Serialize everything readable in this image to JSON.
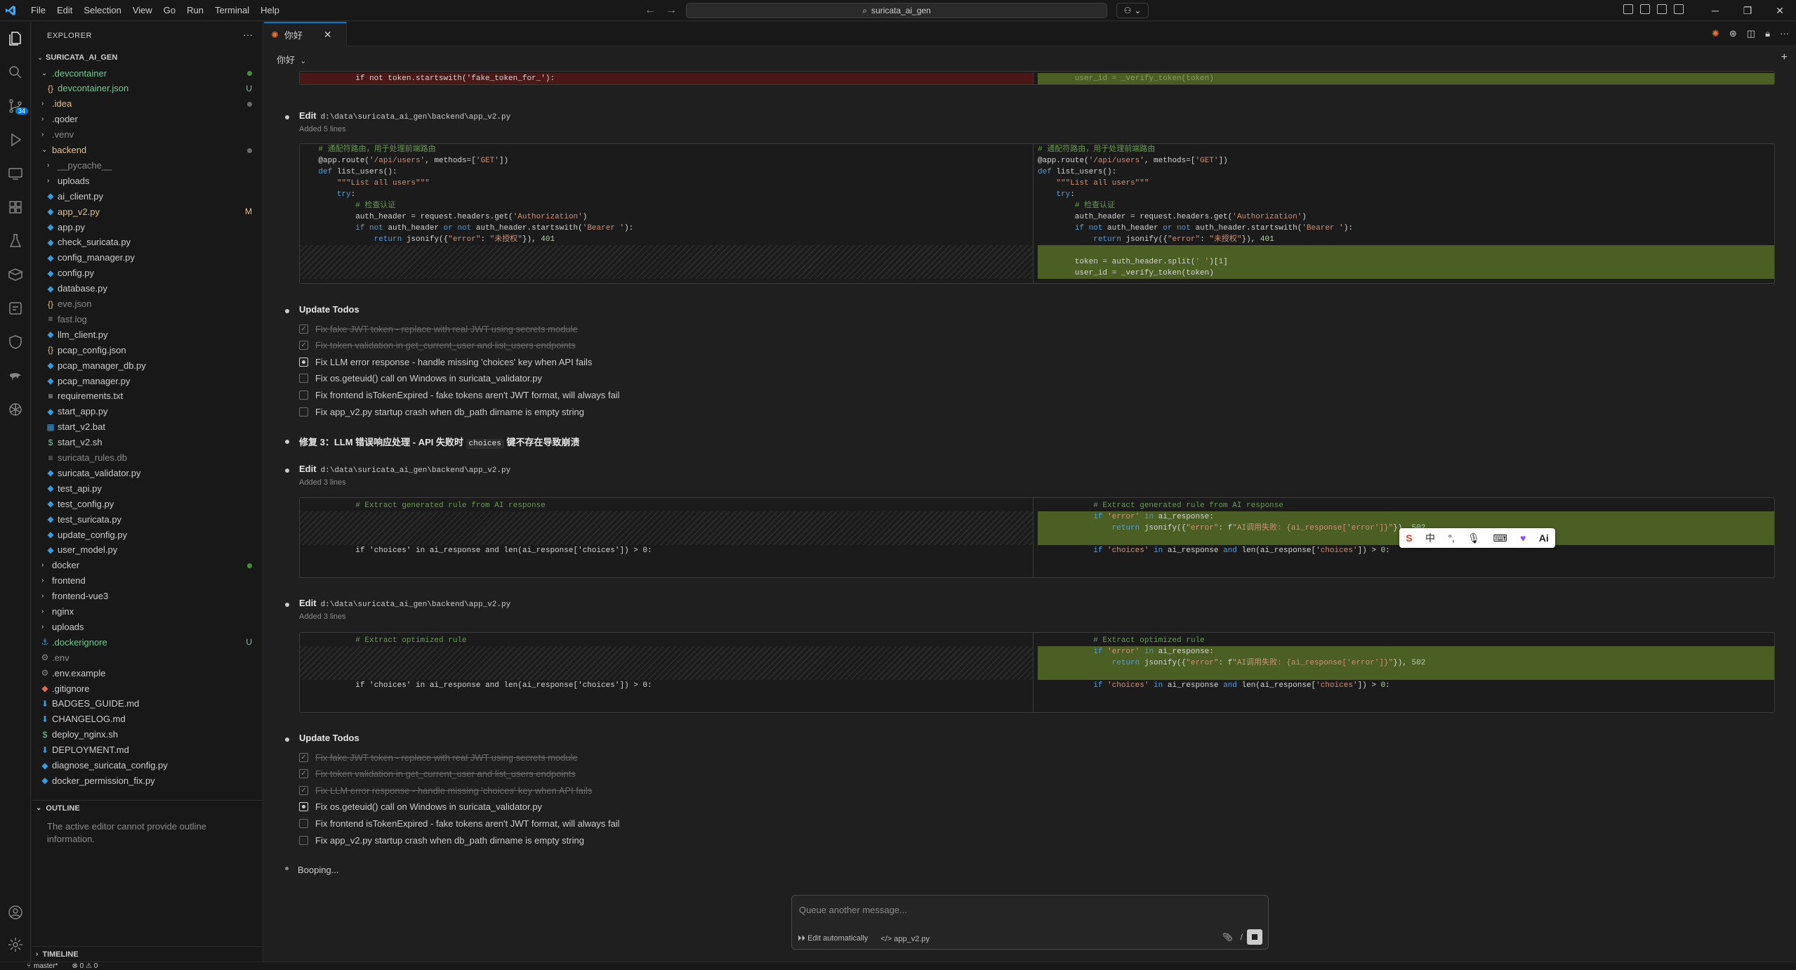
{
  "titlebar": {
    "menu": [
      "File",
      "Edit",
      "Selection",
      "View",
      "Go",
      "Run",
      "Terminal",
      "Help"
    ],
    "search": "suricata_ai_gen"
  },
  "activity": {
    "badge": "34"
  },
  "explorer": {
    "header": "EXPLORER",
    "root": "SURICATA_AI_GEN",
    "rows": [
      {
        "name": ".devcontainer",
        "type": "folder",
        "open": true,
        "level": 1,
        "color": "#73c991",
        "status": "dot"
      },
      {
        "name": "devcontainer.json",
        "type": "json",
        "level": 2,
        "color": "#73c991",
        "status": "U"
      },
      {
        "name": ".idea",
        "type": "folder",
        "level": 1,
        "color": "#e2c08d",
        "status": "dotg"
      },
      {
        "name": ".qoder",
        "type": "folder",
        "level": 1,
        "color": "#cccccc",
        "status": ""
      },
      {
        "name": ".venv",
        "type": "folder",
        "level": 1,
        "color": "#8a8a8a",
        "status": ""
      },
      {
        "name": "backend",
        "type": "folder",
        "open": true,
        "level": 1,
        "color": "#e2c08d",
        "status": "dotg"
      },
      {
        "name": "__pycache__",
        "type": "folder",
        "level": 2,
        "color": "#8a8a8a",
        "status": ""
      },
      {
        "name": "uploads",
        "type": "folder",
        "level": 2,
        "color": "#cccccc",
        "status": ""
      },
      {
        "name": "ai_client.py",
        "type": "py",
        "level": 2,
        "color": "#cccccc",
        "status": ""
      },
      {
        "name": "app_v2.py",
        "type": "py",
        "level": 2,
        "color": "#e2c08d",
        "status": "M"
      },
      {
        "name": "app.py",
        "type": "py",
        "level": 2,
        "color": "#cccccc",
        "status": ""
      },
      {
        "name": "check_suricata.py",
        "type": "py",
        "level": 2,
        "color": "#cccccc",
        "status": ""
      },
      {
        "name": "config_manager.py",
        "type": "py",
        "level": 2,
        "color": "#cccccc",
        "status": ""
      },
      {
        "name": "config.py",
        "type": "py",
        "level": 2,
        "color": "#cccccc",
        "status": ""
      },
      {
        "name": "database.py",
        "type": "py",
        "level": 2,
        "color": "#cccccc",
        "status": ""
      },
      {
        "name": "eve.json",
        "type": "json",
        "level": 2,
        "color": "#8a8a8a",
        "status": ""
      },
      {
        "name": "fast.log",
        "type": "log",
        "level": 2,
        "color": "#8a8a8a",
        "status": ""
      },
      {
        "name": "llm_client.py",
        "type": "py",
        "level": 2,
        "color": "#cccccc",
        "status": ""
      },
      {
        "name": "pcap_config.json",
        "type": "json",
        "level": 2,
        "color": "#cccccc",
        "status": ""
      },
      {
        "name": "pcap_manager_db.py",
        "type": "py",
        "level": 2,
        "color": "#cccccc",
        "status": ""
      },
      {
        "name": "pcap_manager.py",
        "type": "py",
        "level": 2,
        "color": "#cccccc",
        "status": ""
      },
      {
        "name": "requirements.txt",
        "type": "txt",
        "level": 2,
        "color": "#cccccc",
        "status": ""
      },
      {
        "name": "start_app.py",
        "type": "py",
        "level": 2,
        "color": "#cccccc",
        "status": ""
      },
      {
        "name": "start_v2.bat",
        "type": "bat",
        "level": 2,
        "color": "#cccccc",
        "status": ""
      },
      {
        "name": "start_v2.sh",
        "type": "sh",
        "level": 2,
        "color": "#cccccc",
        "status": ""
      },
      {
        "name": "suricata_rules.db",
        "type": "db",
        "level": 2,
        "color": "#8a8a8a",
        "status": ""
      },
      {
        "name": "suricata_validator.py",
        "type": "py",
        "level": 2,
        "color": "#cccccc",
        "status": ""
      },
      {
        "name": "test_api.py",
        "type": "py",
        "level": 2,
        "color": "#cccccc",
        "status": ""
      },
      {
        "name": "test_config.py",
        "type": "py",
        "level": 2,
        "color": "#cccccc",
        "status": ""
      },
      {
        "name": "test_suricata.py",
        "type": "py",
        "level": 2,
        "color": "#cccccc",
        "status": ""
      },
      {
        "name": "update_config.py",
        "type": "py",
        "level": 2,
        "color": "#cccccc",
        "status": ""
      },
      {
        "name": "user_model.py",
        "type": "py",
        "level": 2,
        "color": "#cccccc",
        "status": ""
      },
      {
        "name": "docker",
        "type": "folder",
        "level": 1,
        "color": "#cccccc",
        "status": "dot"
      },
      {
        "name": "frontend",
        "type": "folder",
        "level": 1,
        "color": "#cccccc",
        "status": ""
      },
      {
        "name": "frontend-vue3",
        "type": "folder",
        "level": 1,
        "color": "#cccccc",
        "status": ""
      },
      {
        "name": "nginx",
        "type": "folder",
        "level": 1,
        "color": "#cccccc",
        "status": ""
      },
      {
        "name": "uploads",
        "type": "folder",
        "level": 1,
        "color": "#cccccc",
        "status": ""
      },
      {
        "name": ".dockerignore",
        "type": "docker",
        "level": 1,
        "color": "#73c991",
        "status": "U"
      },
      {
        "name": ".env",
        "type": "env",
        "level": 1,
        "color": "#8a8a8a",
        "status": ""
      },
      {
        "name": ".env.example",
        "type": "env",
        "level": 1,
        "color": "#cccccc",
        "status": ""
      },
      {
        "name": ".gitignore",
        "type": "git",
        "level": 1,
        "color": "#cccccc",
        "status": ""
      },
      {
        "name": "BADGES_GUIDE.md",
        "type": "md",
        "level": 1,
        "color": "#cccccc",
        "status": ""
      },
      {
        "name": "CHANGELOG.md",
        "type": "md",
        "level": 1,
        "color": "#cccccc",
        "status": ""
      },
      {
        "name": "deploy_nginx.sh",
        "type": "sh",
        "level": 1,
        "color": "#cccccc",
        "status": ""
      },
      {
        "name": "DEPLOYMENT.md",
        "type": "md",
        "level": 1,
        "color": "#cccccc",
        "status": ""
      },
      {
        "name": "diagnose_suricata_config.py",
        "type": "py",
        "level": 1,
        "color": "#cccccc",
        "status": ""
      },
      {
        "name": "docker_permission_fix.py",
        "type": "py",
        "level": 1,
        "color": "#cccccc",
        "status": ""
      }
    ],
    "outline_header": "OUTLINE",
    "outline_message": "The active editor cannot provide outline information.",
    "timeline_header": "TIMELINE"
  },
  "tab": {
    "label": "你好"
  },
  "crumb": "你好",
  "edit1": {
    "title": "Edit",
    "path": "d:\\data\\suricata_ai_gen\\backend\\app_v2.py",
    "sub": "Added 5 lines",
    "left": [
      "    # 通配符路由，用于处理前端路由",
      "    @app.route('/api/users', methods=['GET'])",
      "    def list_users():",
      "        \"\"\"List all users\"\"\"",
      "        try:",
      "            # 检查认证",
      "            auth_header = request.headers.get('Authorization')",
      "            if not auth_header or not auth_header.startswith('Bearer '):",
      "                return jsonify({\"error\": \"未授权\"}), 401"
    ],
    "right": [
      "# 通配符路由，用于处理前端路由",
      "@app.route('/api/users', methods=['GET'])",
      "def list_users():",
      "    \"\"\"List all users\"\"\"",
      "    try:",
      "        # 检查认证",
      "        auth_header = request.headers.get('Authorization')",
      "        if not auth_header or not auth_header.startswith('Bearer '):",
      "            return jsonify({\"error\": \"未授权\"}), 401",
      "",
      "        token = auth_header.split(' ')[1]",
      "        user_id = _verify_token(token)"
    ]
  },
  "top_snippet": {
    "left": "            if not token.startswith('fake_token_for_'):",
    "right": "        user_id = _verify_token(token)"
  },
  "todos1": {
    "title": "Update Todos",
    "items": [
      {
        "text": "Fix fake JWT token - replace with real JWT using secrets module",
        "state": "done"
      },
      {
        "text": "Fix token validation in get_current_user and list_users endpoints",
        "state": "done"
      },
      {
        "text": "Fix LLM error response - handle missing 'choices' key when API fails",
        "state": "progress"
      },
      {
        "text": "Fix os.geteuid() call on Windows in suricata_validator.py",
        "state": "todo"
      },
      {
        "text": "Fix frontend isTokenExpired - fake tokens aren't JWT format, will always fail",
        "state": "todo"
      },
      {
        "text": "Fix app_v2.py startup crash when db_path dirname is empty string",
        "state": "todo"
      }
    ]
  },
  "fix3": {
    "prefix": "修复 3：LLM 错误响应处理 - API 失败时",
    "code": "choices",
    "suffix": "键不存在导致崩溃"
  },
  "edit2": {
    "title": "Edit",
    "path": "d:\\data\\suricata_ai_gen\\backend\\app_v2.py",
    "sub": "Added 3 lines",
    "left_comment": "            # Extract generated rule from AI response",
    "left_line": "            if 'choices' in ai_response and len(ai_response['choices']) > 0:",
    "right": [
      "            # Extract generated rule from AI response",
      "            if 'error' in ai_response:",
      "                return jsonify({\"error\": f\"AI调用失败: {ai_response['error']}\"}), 502",
      "",
      "            if 'choices' in ai_response and len(ai_response['choices']) > 0:"
    ]
  },
  "edit3": {
    "title": "Edit",
    "path": "d:\\data\\suricata_ai_gen\\backend\\app_v2.py",
    "sub": "Added 3 lines",
    "left_comment": "            # Extract optimized rule",
    "left_line": "            if 'choices' in ai_response and len(ai_response['choices']) > 0:",
    "right": [
      "            # Extract optimized rule",
      "            if 'error' in ai_response:",
      "                return jsonify({\"error\": f\"AI调用失败: {ai_response['error']}\"}), 502",
      "",
      "            if 'choices' in ai_response and len(ai_response['choices']) > 0:"
    ]
  },
  "todos2": {
    "title": "Update Todos",
    "items": [
      {
        "text": "Fix fake JWT token - replace with real JWT using secrets module",
        "state": "done"
      },
      {
        "text": "Fix token validation in get_current_user and list_users endpoints",
        "state": "done"
      },
      {
        "text": "Fix LLM error response - handle missing 'choices' key when API fails",
        "state": "done"
      },
      {
        "text": "Fix os.geteuid() call on Windows in suricata_validator.py",
        "state": "progress"
      },
      {
        "text": "Fix frontend isTokenExpired - fake tokens aren't JWT format, will always fail",
        "state": "todo"
      },
      {
        "text": "Fix app_v2.py startup crash when db_path dirname is empty string",
        "state": "todo"
      }
    ]
  },
  "status_line": "Booping...",
  "queue": {
    "placeholder": "Queue another message...",
    "mode": "Edit automatically",
    "file": "app_v2.py"
  },
  "statusbar": {
    "branch": "master*",
    "problems": "0 ⚠ 0"
  },
  "ime": {
    "zh": "中",
    "ai": "Ai"
  },
  "colors": {
    "accent": "#0078d4",
    "added": "#4b5e24",
    "removed": "#4b1818"
  }
}
